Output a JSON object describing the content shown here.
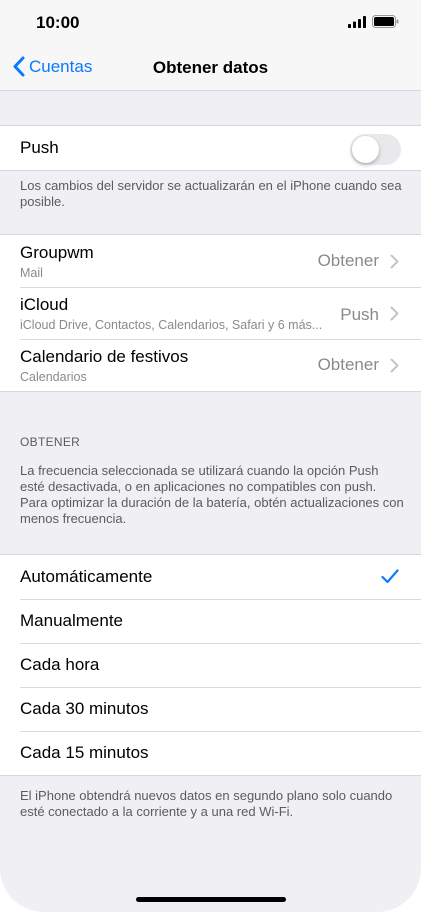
{
  "status_bar": {
    "time": "10:00"
  },
  "nav": {
    "back_label": "Cuentas",
    "title": "Obtener datos"
  },
  "push_section": {
    "label": "Push",
    "toggle_on": false,
    "footnote": "Los cambios del servidor se actualizarán en el iPhone cuando sea posible."
  },
  "accounts": [
    {
      "name": "Groupwm",
      "detail": "Mail",
      "value": "Obtener"
    },
    {
      "name": "iCloud",
      "detail": "iCloud Drive, Contactos, Calendarios, Safari y 6 más...",
      "value": "Push"
    },
    {
      "name": "Calendario de festivos",
      "detail": "Calendarios",
      "value": "Obtener"
    }
  ],
  "fetch_section": {
    "header": "OBTENER",
    "description": "La frecuencia seleccionada se utilizará cuando la opción Push esté desactivada, o en aplicaciones no compatibles con push. Para optimizar la duración de la batería, obtén actualizaciones con menos frecuencia.",
    "options": [
      {
        "label": "Automáticamente",
        "selected": true
      },
      {
        "label": "Manualmente",
        "selected": false
      },
      {
        "label": "Cada hora",
        "selected": false
      },
      {
        "label": "Cada 30 minutos",
        "selected": false
      },
      {
        "label": "Cada 15 minutos",
        "selected": false
      }
    ],
    "footnote": "El iPhone obtendrá nuevos datos en segundo plano solo cuando esté conectado a la corriente y a una red Wi-Fi."
  },
  "colors": {
    "accent": "#0a7aff",
    "background": "#efeff4",
    "secondary_text": "#8a8a8e"
  }
}
